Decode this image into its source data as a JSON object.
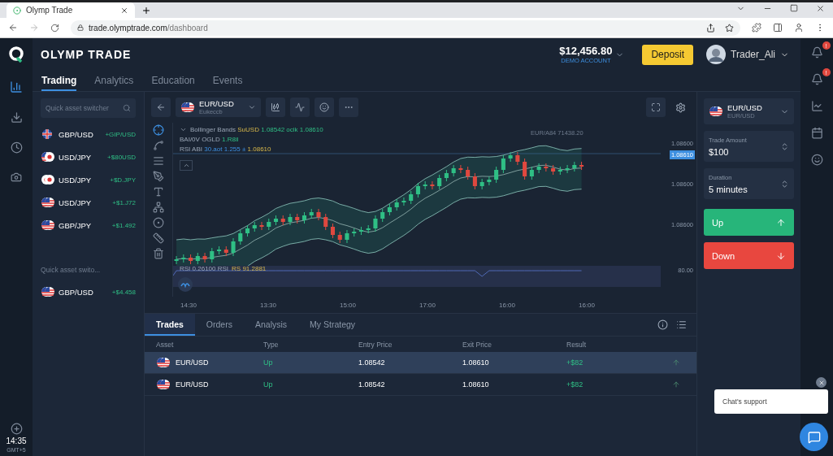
{
  "browser": {
    "tab_title": "Olymp Trade",
    "url_host": "trade.olymptrade.com",
    "url_path": "/dashboard"
  },
  "header": {
    "brand": "OLYMP TRADE",
    "balance": "$12,456.80",
    "account": "DEMO ACCOUNT",
    "deposit": "Deposit",
    "user": "Trader_Ali"
  },
  "nav": [
    {
      "label": "Trading",
      "selected": true
    },
    {
      "label": "Analytics",
      "selected": false
    },
    {
      "label": "Education",
      "selected": false
    },
    {
      "label": "Events",
      "selected": false
    }
  ],
  "asset_search": {
    "placeholder": "Quick asset switcher"
  },
  "assets": [
    {
      "name": "GBP/USD",
      "change": "+GIP/USD",
      "kind": "gb"
    },
    {
      "name": "USD/JPY",
      "change": "+$80USD",
      "kind": "us-jp"
    },
    {
      "name": "USD/JPY",
      "change": "+$D.JPY",
      "kind": "jp"
    },
    {
      "name": "USD/JPY",
      "change": "+$1.J72",
      "kind": "us"
    },
    {
      "name": "GBP/JPY",
      "change": "+$1.492",
      "kind": "us"
    }
  ],
  "recent_label": "Quick asset swito...",
  "recent_assets": [
    {
      "name": "GBP/USD",
      "change": "+$4.458",
      "kind": "us"
    }
  ],
  "clock": {
    "time": "14:35",
    "zone": "GMT+5"
  },
  "rail_badges": [
    {
      "count": "!"
    },
    {
      "count": "!"
    }
  ],
  "chart": {
    "symbol": "EUR/USD",
    "symbol_sub": "Eukeccb",
    "indicators": [
      {
        "name": "Bollinger Bands",
        "tag": "SuUSD",
        "values": "1.08542 ocik 1.08610",
        "expanded": true
      },
      {
        "name": "BAI/0V OGLD",
        "values": "1.R8il"
      },
      {
        "name": "RSI  ABI",
        "tag": "30.aot 1.255 ±",
        "values": "1.08610"
      }
    ],
    "marker_label": "EUR/A84 71438.20",
    "price_ticks": [
      {
        "label": "1.08600",
        "current": false
      },
      {
        "label": "1.08610",
        "current": true
      },
      {
        "label": "1.08600",
        "current": false
      },
      {
        "label": "1.08600",
        "current": false
      }
    ],
    "rsi": {
      "label": "RSI  0.26100  RSI",
      "value": "RS  91.2881",
      "tick": "80.00"
    },
    "time_ticks": [
      "14:30",
      "13:30",
      "15:00",
      "17:00",
      "16:00",
      "16:00"
    ]
  },
  "bottom_tabs": [
    {
      "label": "Trades",
      "selected": true
    },
    {
      "label": "Orders",
      "selected": false
    },
    {
      "label": "Analysis",
      "selected": false
    },
    {
      "label": "My Strategy",
      "selected": false
    }
  ],
  "table": {
    "columns": [
      "Asset",
      "Type",
      "Entry Price",
      "Exit Price",
      "Result"
    ],
    "rows": [
      {
        "asset": "EUR/USD",
        "type": "Up",
        "entry": "1.08542",
        "exit": "1.08610",
        "result": "+$82",
        "selected": true
      },
      {
        "asset": "EUR/USD",
        "type": "Up",
        "entry": "1.08542",
        "exit": "1.08610",
        "result": "+$82",
        "selected": false
      }
    ]
  },
  "trade_panel": {
    "asset": "EUR/USD",
    "asset_sub": "EUR/USD",
    "amount_label": "Trade Amount",
    "amount": "$100",
    "duration_label": "Duration",
    "duration": "5 minutes",
    "up": "Up",
    "down": "Down"
  },
  "chat": {
    "message": "Chat's support"
  }
}
